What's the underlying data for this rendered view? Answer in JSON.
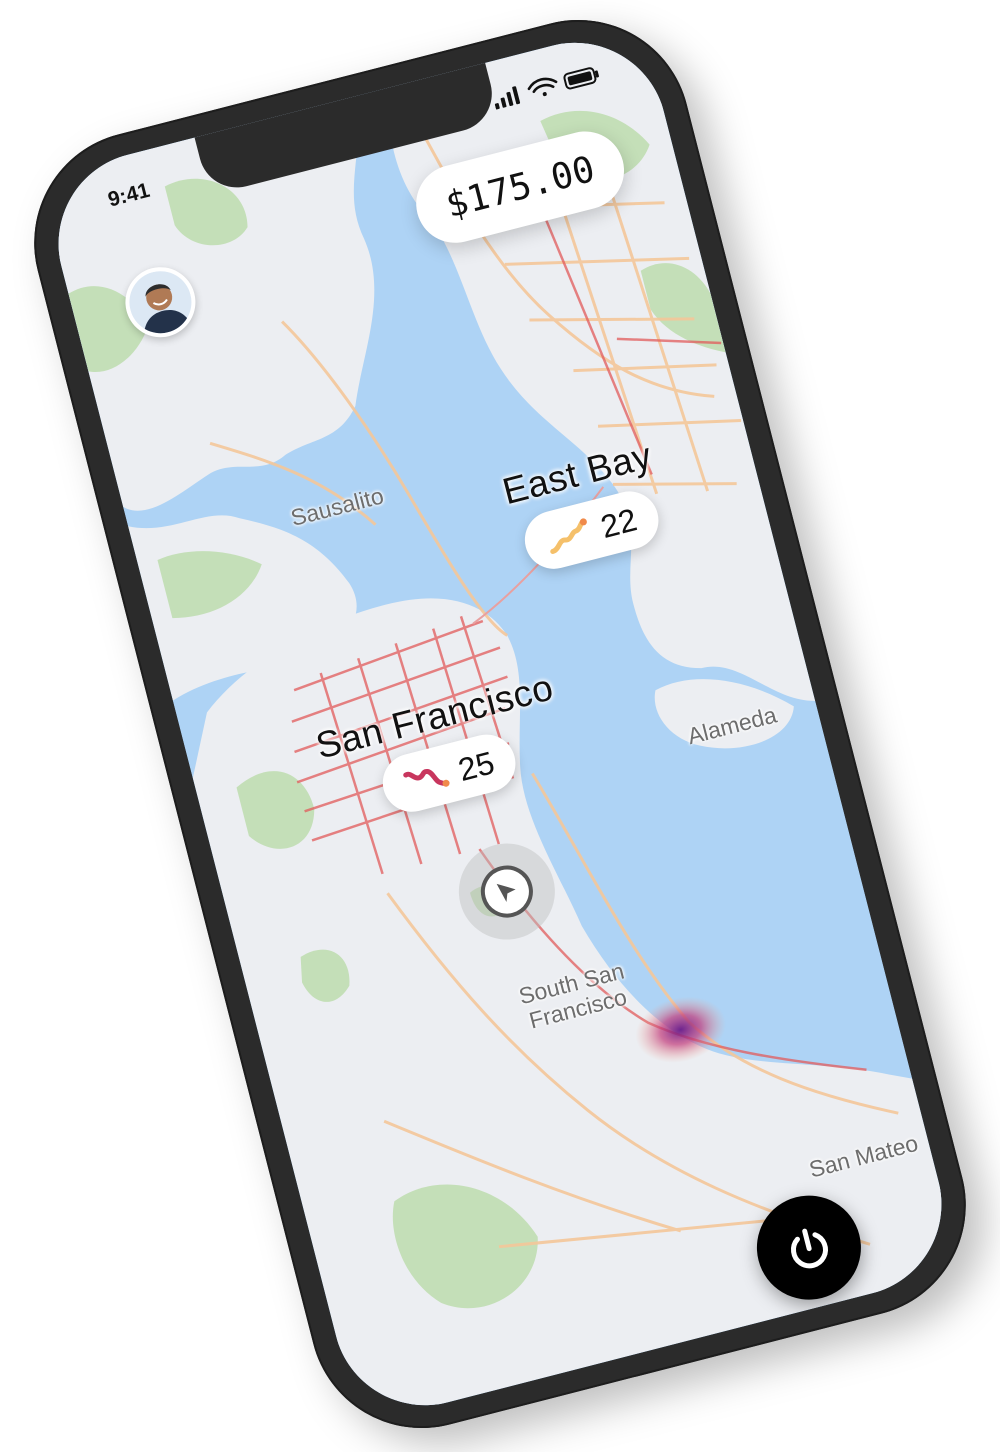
{
  "status_bar": {
    "time": "9:41"
  },
  "earnings": {
    "amount": "$175.00"
  },
  "regions": [
    {
      "name": "East Bay",
      "count": "22",
      "trend": "rising"
    },
    {
      "name": "San Francisco",
      "count": "25",
      "trend": "falling"
    }
  ],
  "place_labels": [
    "Sausalito",
    "Alameda",
    "South San\nFrancisco",
    "San Mateo"
  ],
  "icons": {
    "cellular": "cellular-signal-icon",
    "wifi": "wifi-icon",
    "battery": "battery-icon",
    "locate": "navigation-arrow-icon",
    "power": "power-icon"
  },
  "colors": {
    "water": "#aed3f5",
    "land": "#eceef2",
    "park": "#c4dfb8",
    "road_hot": "#e25b5b",
    "road_warm": "#f4c79a",
    "phone": "#2b2b2b"
  }
}
